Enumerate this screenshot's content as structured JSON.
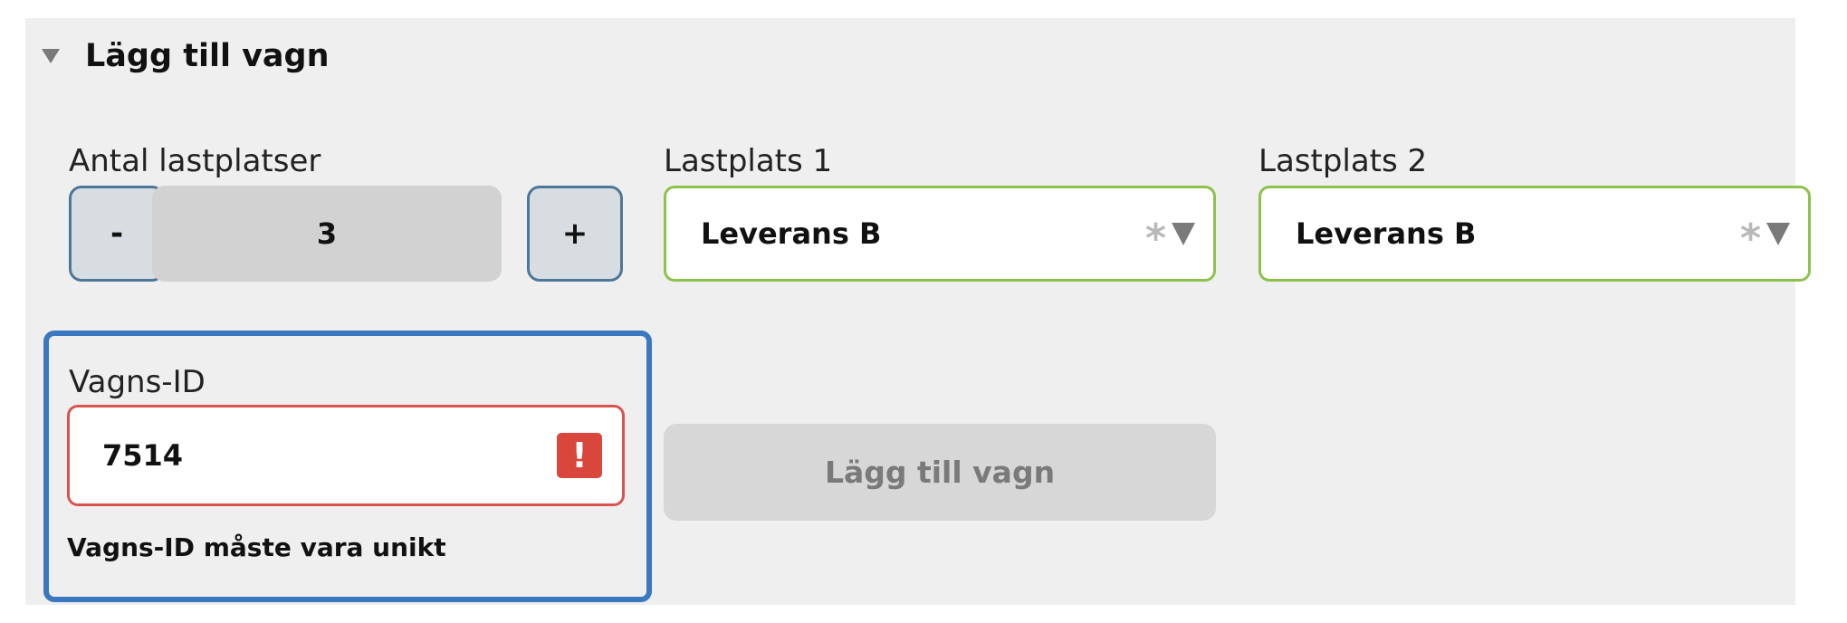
{
  "section": {
    "title": "Lägg till vagn",
    "expanded": true
  },
  "quantity": {
    "label": "Antal lastplatser",
    "decrement_label": "-",
    "increment_label": "+",
    "value": "3"
  },
  "load_places": [
    {
      "label": "Lastplats 1",
      "value": "Leverans B",
      "required_marker": "*"
    },
    {
      "label": "Lastplats 2",
      "value": "Leverans B",
      "required_marker": "*"
    }
  ],
  "wagon_id": {
    "label": "Vagns-ID",
    "value": "7514",
    "error_icon_glyph": "!",
    "error_message": "Vagns-ID måste vara unikt"
  },
  "add_button": {
    "label": "Lägg till vagn",
    "enabled": false
  },
  "colors": {
    "panel_background": "#efefef",
    "valid_border": "#8cc24a",
    "error_border": "#d9534f",
    "focus_border": "#3a78bf",
    "stepper_border": "#4d7799"
  },
  "icons": {
    "section_toggle": "caret-down-icon",
    "select_dropdown": "chevron-down-icon",
    "error": "exclamation-icon"
  }
}
